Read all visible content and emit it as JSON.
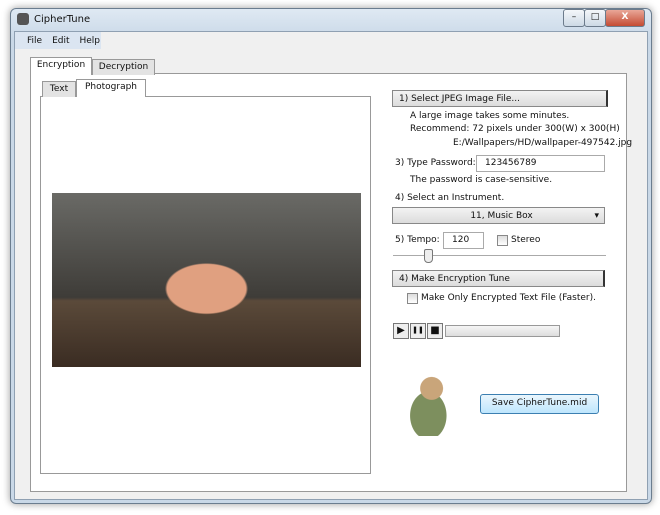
{
  "window": {
    "title": "CipherTune",
    "minimize": "–",
    "maximize": "□",
    "close": "X"
  },
  "menu": [
    "File",
    "Edit",
    "Help"
  ],
  "tabs": [
    "Encryption",
    "Decryption"
  ],
  "subtabs": [
    "Text",
    "Photograph"
  ],
  "right": {
    "select_btn": "1) Select JPEG Image File...",
    "note1": "A large image takes some minutes.",
    "note2": "Recommend: 72 pixels under 300(W) x 300(H)",
    "file_path": "E:/Wallpapers/HD/wallpaper-497542.jpg",
    "password_label": "3) Type Password:",
    "password_value": "123456789",
    "password_note": "The password is case-sensitive.",
    "instrument_label": "4) Select an Instrument.",
    "instrument_value": "11, Music Box",
    "tempo_label": "5) Tempo:",
    "tempo_value": "120",
    "stereo_label": "Stereo",
    "tempo_slider_fraction": 0.15,
    "make_btn": "4) Make Encryption Tune",
    "only_text_label": "Make Only Encrypted Text File (Faster).",
    "play": "▶",
    "pause": "❚❚",
    "stop": "■",
    "save_btn": "Save CipherTune.mid"
  }
}
